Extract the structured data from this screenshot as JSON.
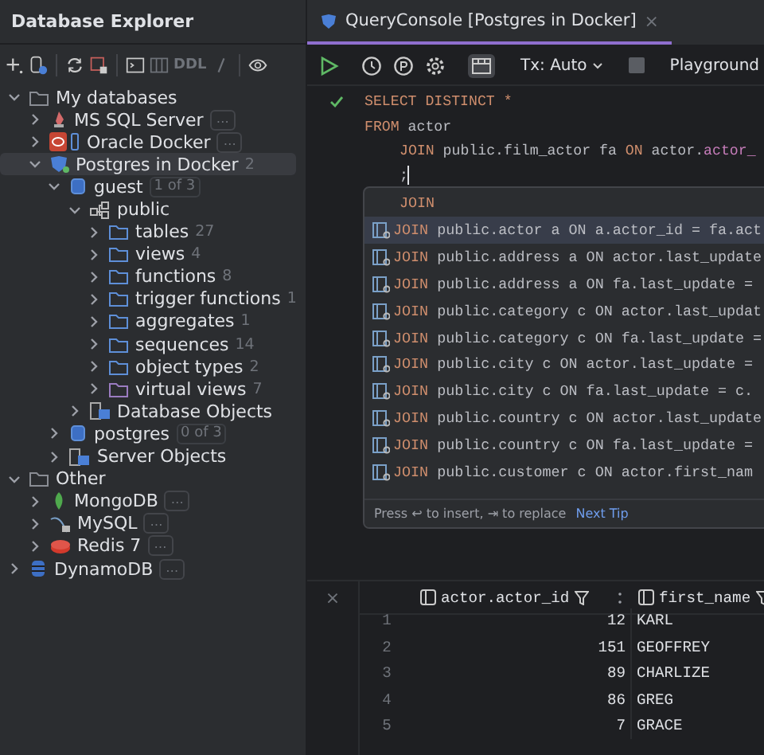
{
  "explorer": {
    "title": "Database Explorer",
    "toolbar": {
      "ddl": "DDL"
    },
    "tree": [
      {
        "label": "My databases",
        "kind": "folder",
        "expanded": true,
        "selected": false,
        "children": [
          {
            "label": "MS SQL Server",
            "kind": "mssql",
            "expanded": false,
            "selected": false,
            "badge": "…"
          },
          {
            "label": "Oracle Docker",
            "kind": "oracle",
            "expanded": false,
            "selected": false,
            "badge": "…"
          },
          {
            "label": "Postgres in Docker",
            "kind": "postgres",
            "expanded": true,
            "selected": true,
            "count": "2",
            "children": [
              {
                "label": "guest",
                "kind": "database",
                "expanded": true,
                "selected": false,
                "scope": "1 of 3",
                "children": [
                  {
                    "label": "public",
                    "kind": "schema",
                    "expanded": true,
                    "selected": false,
                    "children": [
                      {
                        "label": "tables",
                        "kind": "folder",
                        "expanded": false,
                        "selected": false,
                        "count": "27"
                      },
                      {
                        "label": "views",
                        "kind": "folder",
                        "expanded": false,
                        "selected": false,
                        "count": "4"
                      },
                      {
                        "label": "functions",
                        "kind": "folder",
                        "expanded": false,
                        "selected": false,
                        "count": "8"
                      },
                      {
                        "label": "trigger functions",
                        "kind": "folder",
                        "expanded": false,
                        "selected": false,
                        "count": "1"
                      },
                      {
                        "label": "aggregates",
                        "kind": "folder",
                        "expanded": false,
                        "selected": false,
                        "count": "1"
                      },
                      {
                        "label": "sequences",
                        "kind": "folder",
                        "expanded": false,
                        "selected": false,
                        "count": "14"
                      },
                      {
                        "label": "object types",
                        "kind": "folder",
                        "expanded": false,
                        "selected": false,
                        "count": "2"
                      },
                      {
                        "label": "virtual views",
                        "kind": "vfolder",
                        "expanded": false,
                        "selected": false,
                        "count": "7"
                      }
                    ]
                  },
                  {
                    "label": "Database Objects",
                    "kind": "objects",
                    "expanded": false,
                    "selected": false
                  }
                ]
              },
              {
                "label": "postgres",
                "kind": "database",
                "expanded": false,
                "selected": false,
                "scope": "0 of 3"
              },
              {
                "label": "Server Objects",
                "kind": "objects",
                "expanded": false,
                "selected": false
              }
            ]
          }
        ]
      },
      {
        "label": "Other",
        "kind": "folder",
        "expanded": true,
        "selected": false,
        "children": [
          {
            "label": "MongoDB",
            "kind": "mongo",
            "expanded": false,
            "selected": false,
            "badge": "…"
          },
          {
            "label": "MySQL",
            "kind": "mysql",
            "expanded": false,
            "selected": false,
            "badge": "…"
          },
          {
            "label": "Redis 7",
            "kind": "redis",
            "expanded": false,
            "selected": false,
            "badge": "…"
          }
        ]
      },
      {
        "label": "DynamoDB",
        "kind": "dynamo",
        "expanded": false,
        "selected": false,
        "badge": "…"
      }
    ]
  },
  "editor": {
    "tab": {
      "title": "QueryConsole [Postgres in Docker]",
      "close": "×",
      "selected": true
    },
    "toolbar": {
      "layout_toggle_on": true,
      "tx_mode": "Tx: Auto",
      "schema": "Playground"
    },
    "lines": [
      {
        "checked": true,
        "kind": "plain",
        "tokens": [
          {
            "kind": "kw",
            "t": "SELECT DISTINCT *"
          }
        ]
      },
      {
        "checked": false,
        "kind": "plain",
        "tokens": [
          {
            "kind": "kw",
            "t": "FROM"
          },
          {
            "kind": "id",
            "t": " actor"
          }
        ]
      },
      {
        "checked": false,
        "kind": "nested",
        "tokens": [
          {
            "kind": "kw",
            "t": "JOIN"
          },
          {
            "kind": "id",
            "t": " public.film_actor fa "
          },
          {
            "kind": "kw",
            "t": "ON"
          },
          {
            "kind": "id",
            "t": " actor."
          },
          {
            "kind": "field",
            "t": "actor_"
          }
        ]
      },
      {
        "checked": false,
        "kind": "nested",
        "tokens": [
          {
            "kind": "id",
            "t": ";"
          }
        ]
      }
    ],
    "completion": {
      "header": "JOIN",
      "items": [
        {
          "keyword": "JOIN",
          "text": "public.actor a ON a.actor_id = fa.act",
          "selected": true
        },
        {
          "keyword": "JOIN",
          "text": "public.address a ON actor.last_update",
          "selected": false
        },
        {
          "keyword": "JOIN",
          "text": "public.address a ON fa.last_update =",
          "selected": false
        },
        {
          "keyword": "JOIN",
          "text": "public.category c ON actor.last_updat",
          "selected": false
        },
        {
          "keyword": "JOIN",
          "text": "public.category c ON fa.last_update =",
          "selected": false
        },
        {
          "keyword": "JOIN",
          "text": "public.city c ON actor.last_update =",
          "selected": false
        },
        {
          "keyword": "JOIN",
          "text": "public.city c ON fa.last_update = c.",
          "selected": false
        },
        {
          "keyword": "JOIN",
          "text": "public.country c ON actor.last_update",
          "selected": false
        },
        {
          "keyword": "JOIN",
          "text": "public.country c ON fa.last_update =",
          "selected": false
        },
        {
          "keyword": "JOIN",
          "text": "public.customer c ON actor.first_nam",
          "selected": false
        }
      ],
      "hint": "Press ↩ to insert, ⇥ to replace",
      "tip_link": "Next Tip"
    },
    "results": {
      "close": "×",
      "columns": [
        {
          "label": "actor.actor_id"
        },
        {
          "label": "first_name"
        }
      ],
      "rows": [
        {
          "number": "1",
          "cells": [
            "12",
            "KARL"
          ]
        },
        {
          "number": "2",
          "cells": [
            "151",
            "GEOFFREY"
          ]
        },
        {
          "number": "3",
          "cells": [
            "89",
            "CHARLIZE"
          ]
        },
        {
          "number": "4",
          "cells": [
            "86",
            "GREG"
          ]
        },
        {
          "number": "5",
          "cells": [
            "7",
            "GRACE"
          ]
        }
      ]
    }
  }
}
